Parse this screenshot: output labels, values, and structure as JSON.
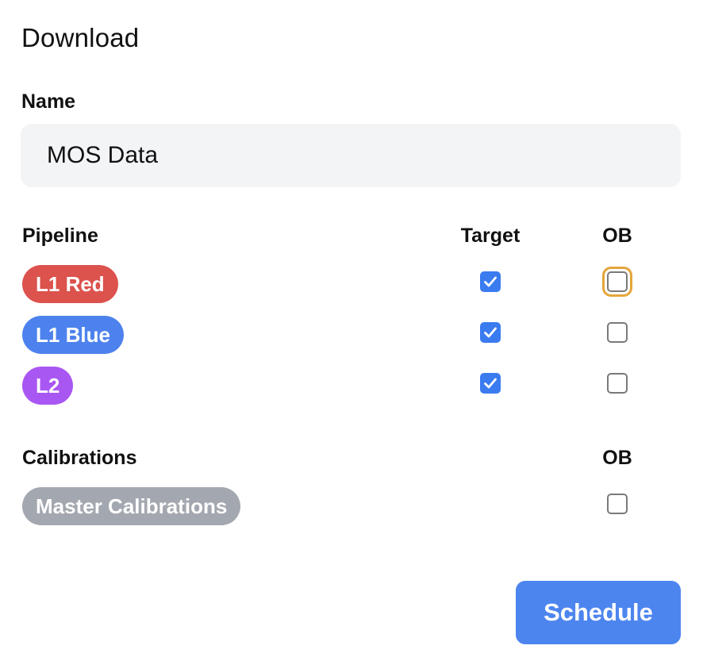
{
  "dialog": {
    "title": "Download"
  },
  "name_field": {
    "label": "Name",
    "value": "MOS Data"
  },
  "pipeline": {
    "heading": "Pipeline",
    "target_heading": "Target",
    "ob_heading": "OB",
    "rows": [
      {
        "label": "L1 Red",
        "color": "#dc524d",
        "target": true,
        "ob": false,
        "ob_focused": true
      },
      {
        "label": "L1 Blue",
        "color": "#4d82ee",
        "target": true,
        "ob": false
      },
      {
        "label": "L2",
        "color": "#a957f2",
        "target": true,
        "ob": false
      }
    ]
  },
  "calibrations": {
    "heading": "Calibrations",
    "ob_heading": "OB",
    "rows": [
      {
        "label": "Master Calibrations",
        "color": "#a3a7af",
        "ob": false
      }
    ]
  },
  "actions": {
    "schedule_label": "Schedule",
    "accent_color": "#4d85ef"
  },
  "icons": {
    "checkmark": "checkmark-icon"
  }
}
